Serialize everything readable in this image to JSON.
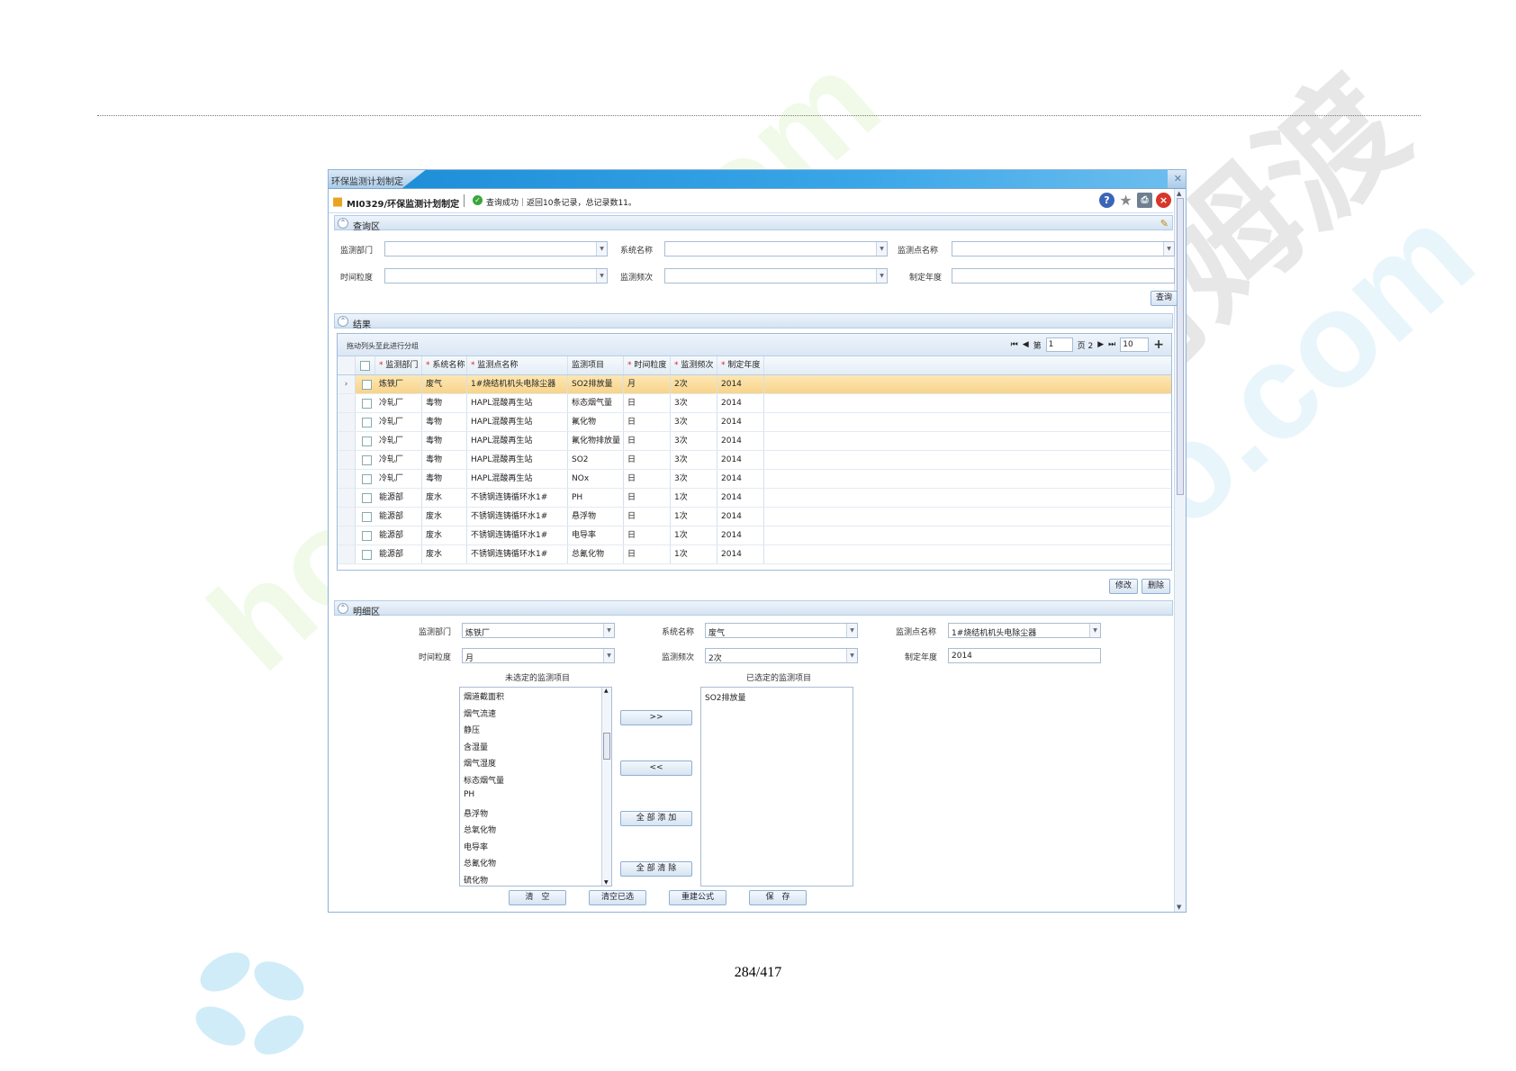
{
  "watermark": {
    "text": "homedo.com",
    "brand": "河姆渡"
  },
  "page_number": "284/417",
  "window": {
    "title": "环保监测计划制定",
    "close_glyph": "✕",
    "module_code": "MI0329/环保监测计划制定",
    "status_message": "查询成功｜返回10条记录，总记录数11。"
  },
  "query_section": {
    "label": "查询区",
    "fields": {
      "dept_label": "监测部门",
      "system_label": "系统名称",
      "point_label": "监测点名称",
      "granularity_label": "时间粒度",
      "frequency_label": "监测频次",
      "year_label": "制定年度"
    },
    "query_button": "查询"
  },
  "result_section": {
    "label": "结果",
    "group_hint": "拖动列头至此进行分组",
    "pager": {
      "first": "⏮",
      "prev": "◀",
      "page_prefix": "第",
      "page": "1",
      "page_suffix": "页 2",
      "next": "▶",
      "last": "⏭",
      "page_size": "10",
      "plus": "+"
    },
    "columns": [
      "监测部门",
      "系统名称",
      "监测点名称",
      "监测项目",
      "时间粒度",
      "监测频次",
      "制定年度"
    ],
    "required_columns": [
      true,
      true,
      true,
      false,
      true,
      true,
      true
    ],
    "rows": [
      [
        "炼铁厂",
        "废气",
        "1#烧结机机头电除尘器",
        "SO2排放量",
        "月",
        "2次",
        "2014"
      ],
      [
        "冷轧厂",
        "毒物",
        "HAPL混酸再生站",
        "标态烟气量",
        "日",
        "3次",
        "2014"
      ],
      [
        "冷轧厂",
        "毒物",
        "HAPL混酸再生站",
        "氟化物",
        "日",
        "3次",
        "2014"
      ],
      [
        "冷轧厂",
        "毒物",
        "HAPL混酸再生站",
        "氟化物排放量",
        "日",
        "3次",
        "2014"
      ],
      [
        "冷轧厂",
        "毒物",
        "HAPL混酸再生站",
        "SO2",
        "日",
        "3次",
        "2014"
      ],
      [
        "冷轧厂",
        "毒物",
        "HAPL混酸再生站",
        "NOx",
        "日",
        "3次",
        "2014"
      ],
      [
        "能源部",
        "废水",
        "不锈钢连铸循环水1#",
        "PH",
        "日",
        "1次",
        "2014"
      ],
      [
        "能源部",
        "废水",
        "不锈钢连铸循环水1#",
        "悬浮物",
        "日",
        "1次",
        "2014"
      ],
      [
        "能源部",
        "废水",
        "不锈钢连铸循环水1#",
        "电导率",
        "日",
        "1次",
        "2014"
      ],
      [
        "能源部",
        "废水",
        "不锈钢连铸循环水1#",
        "总氰化物",
        "日",
        "1次",
        "2014"
      ]
    ],
    "edit_button": "修改",
    "delete_button": "删除"
  },
  "detail_section": {
    "label": "明细区",
    "dept_label": "监测部门",
    "dept_value": "炼铁厂",
    "system_label": "系统名称",
    "system_value": "废气",
    "point_label": "监测点名称",
    "point_value": "1#烧结机机头电除尘器",
    "granularity_label": "时间粒度",
    "granularity_value": "月",
    "frequency_label": "监测频次",
    "frequency_value": "2次",
    "year_label": "制定年度",
    "year_value": "2014",
    "unselected_title": "未选定的监测项目",
    "selected_title": "已选定的监测项目",
    "unselected_items": [
      "烟道截面积",
      "烟气流速",
      "静压",
      "含湿量",
      "烟气湿度",
      "标态烟气量",
      "PH",
      "悬浮物",
      "总氧化物",
      "电导率",
      "总氰化物",
      "硫化物"
    ],
    "selected_items": [
      "SO2排放量"
    ],
    "add_button": ">>",
    "remove_button": "<<",
    "add_all_button": "全 部 添 加",
    "clear_all_button": "全 部 清 除",
    "clear_button": "清　空",
    "clear_selected_button": "清空已选",
    "formula_button": "重建公式",
    "save_button": "保　存"
  }
}
